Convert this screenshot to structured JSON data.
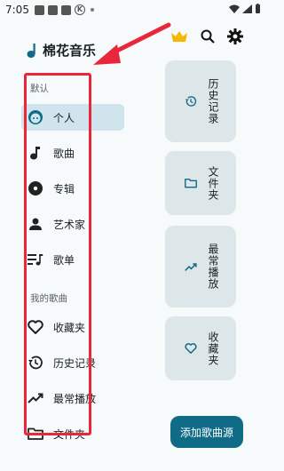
{
  "status_bar": {
    "time": "7:05"
  },
  "app": {
    "title": "棉花音乐"
  },
  "sections": {
    "default": "默认",
    "my_songs": "我的歌曲"
  },
  "nav": {
    "items": [
      {
        "label": "个人",
        "icon": "person-face-icon",
        "active": true
      },
      {
        "label": "歌曲",
        "icon": "music-note-icon"
      },
      {
        "label": "专辑",
        "icon": "album-icon"
      },
      {
        "label": "艺术家",
        "icon": "artist-icon"
      },
      {
        "label": "歌单",
        "icon": "playlist-icon"
      },
      {
        "label": "收藏夹",
        "icon": "heart-icon"
      },
      {
        "label": "历史记录",
        "icon": "history-icon"
      },
      {
        "label": "最常播放",
        "icon": "trending-up-icon"
      },
      {
        "label": "文件夹",
        "icon": "folder-icon"
      }
    ]
  },
  "quick_cards": [
    {
      "label": "历史记录",
      "icon": "history-icon"
    },
    {
      "label": "文件夹",
      "icon": "folder-icon"
    },
    {
      "label": "最常播放",
      "icon": "trending-up-icon"
    },
    {
      "label": "收藏夹",
      "icon": "heart-icon"
    }
  ],
  "fab": {
    "label": "添加歌曲源"
  },
  "colors": {
    "accent": "#0f6b86",
    "active_bg": "#cfe4ec",
    "card_bg": "#dde7ea",
    "highlight": "#e8283a",
    "crown": "#f5b800"
  }
}
